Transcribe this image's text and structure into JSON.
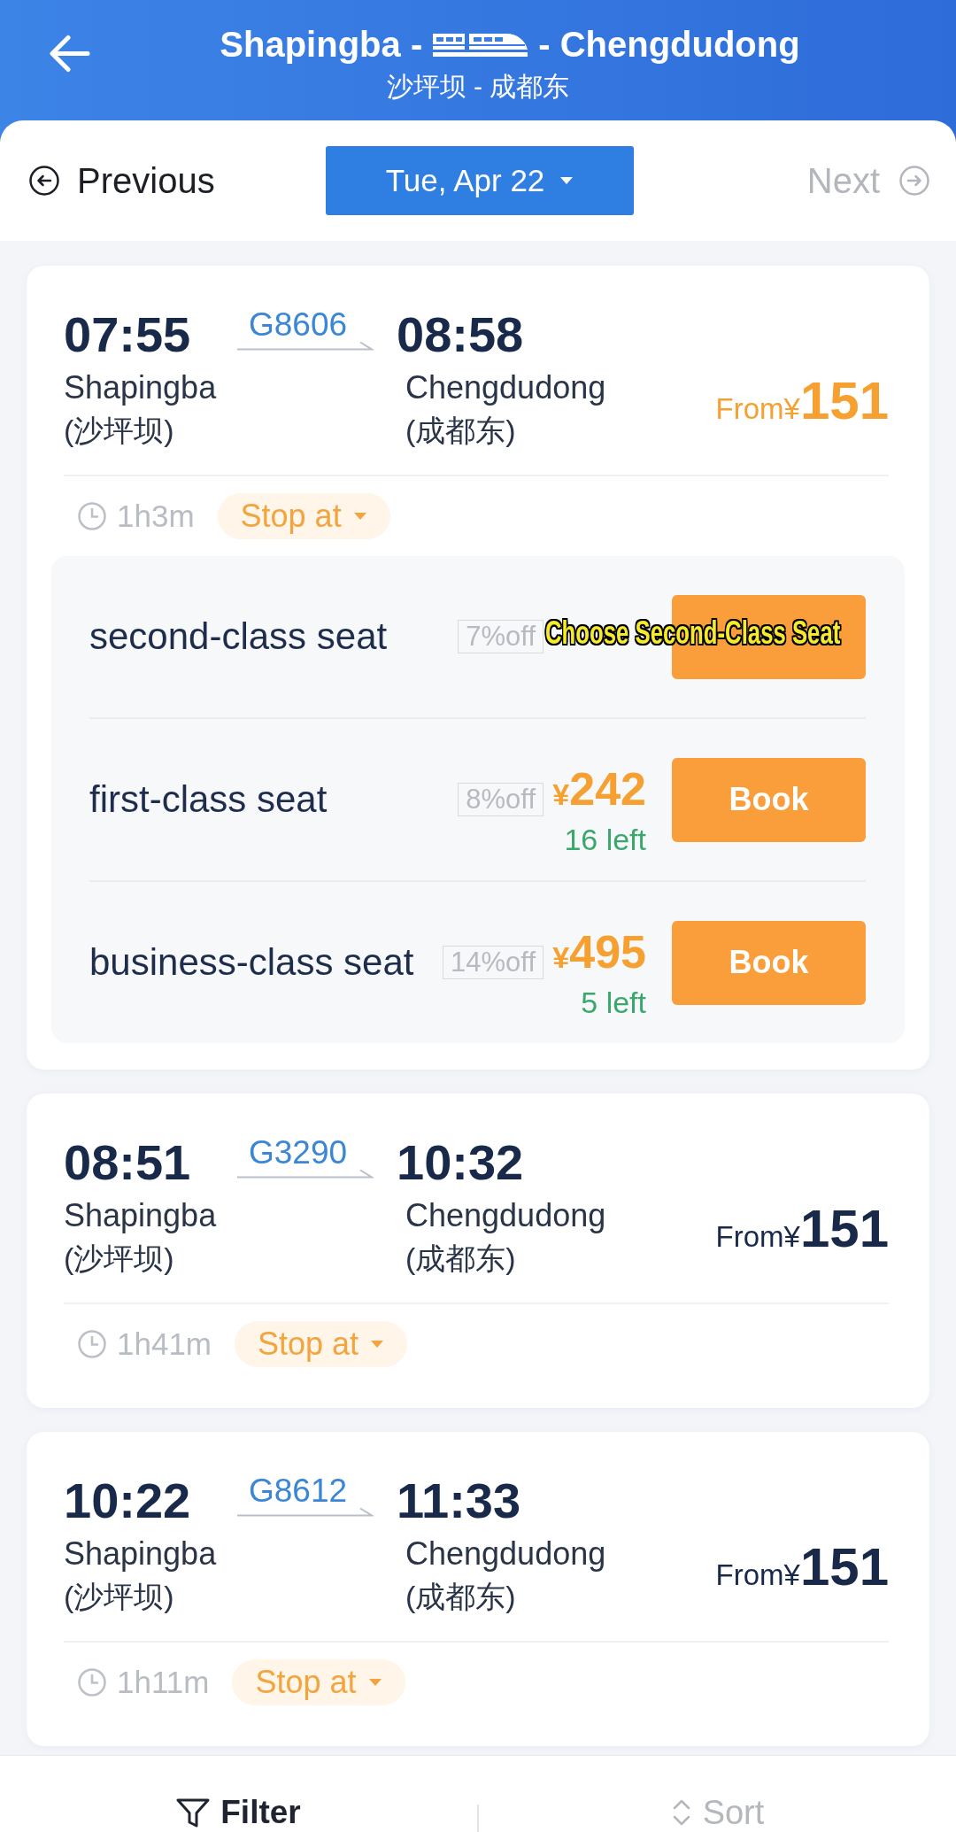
{
  "header": {
    "title_from": "Shapingba -",
    "title_to": "- Chengdudong",
    "subtitle": "沙坪坝 - 成都东"
  },
  "date_bar": {
    "previous": {
      "label": "Previous",
      "disabled": false
    },
    "date": "Tue, Apr 22",
    "next": {
      "label": "Next",
      "disabled": true
    }
  },
  "trains": [
    {
      "depart_time": "07:55",
      "train_no": "G8606",
      "arrive_time": "08:58",
      "from_station": "Shapingba",
      "from_station_cn": "(沙坪坝)",
      "to_station": "Chengdudong",
      "to_station_cn": "(成都东)",
      "price_prefix": "From¥",
      "price": "151",
      "duration": "1h3m",
      "stops": "Stop at",
      "expanded": true,
      "seats": [
        {
          "name": "second-class seat",
          "discount": "7%off"
        },
        {
          "name": "first-class seat",
          "discount": "8%off",
          "currency": "¥",
          "price": "242",
          "left": "16 left",
          "button": "Book"
        },
        {
          "name": "business-class seat",
          "discount": "14%off",
          "currency": "¥",
          "price": "495",
          "left": "5 left",
          "button": "Book"
        }
      ]
    },
    {
      "depart_time": "08:51",
      "train_no": "G3290",
      "arrive_time": "10:32",
      "from_station": "Shapingba",
      "from_station_cn": "(沙坪坝)",
      "to_station": "Chengdudong",
      "to_station_cn": "(成都东)",
      "price_prefix": "From¥",
      "price": "151",
      "duration": "1h41m",
      "stops": "Stop at",
      "expanded": false
    },
    {
      "depart_time": "10:22",
      "train_no": "G8612",
      "arrive_time": "11:33",
      "from_station": "Shapingba",
      "from_station_cn": "(沙坪坝)",
      "to_station": "Chengdudong",
      "to_station_cn": "(成都东)",
      "price_prefix": "From¥",
      "price": "151",
      "duration": "1h11m",
      "stops": "Stop at",
      "expanded": false
    }
  ],
  "caption": "Choose Second-Class Seat",
  "bottom_bar": [
    {
      "kind": "filter",
      "label": "Filter",
      "selected": true
    },
    {
      "kind": "sort",
      "label": "Sort",
      "selected": false
    }
  ]
}
